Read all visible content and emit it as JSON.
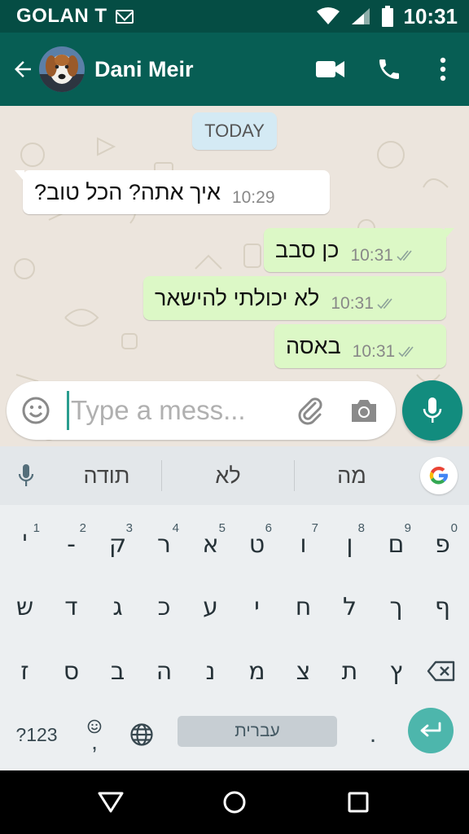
{
  "status_bar": {
    "carrier": "GOLAN T",
    "time": "10:31"
  },
  "app_bar": {
    "contact_name": "Dani Meir"
  },
  "chat": {
    "date_label": "TODAY",
    "messages": [
      {
        "direction": "incoming",
        "text": "איך אתה? הכל טוב?",
        "time": "10:29"
      },
      {
        "direction": "outgoing",
        "text": "כן סבב",
        "time": "10:31",
        "status": "delivered"
      },
      {
        "direction": "outgoing",
        "text": "לא יכולתי להישאר",
        "time": "10:31",
        "status": "delivered"
      },
      {
        "direction": "outgoing",
        "text": "באסה",
        "time": "10:31",
        "status": "delivered"
      }
    ]
  },
  "composer": {
    "placeholder": "Type a mess..."
  },
  "keyboard": {
    "suggestions": [
      "תודה",
      "לא",
      "מה"
    ],
    "row1": [
      {
        "label": "פ",
        "hint": "0"
      },
      {
        "label": "ם",
        "hint": "9"
      },
      {
        "label": "ן",
        "hint": "8"
      },
      {
        "label": "ו",
        "hint": "7"
      },
      {
        "label": "ט",
        "hint": "6"
      },
      {
        "label": "א",
        "hint": "5"
      },
      {
        "label": "ר",
        "hint": "4"
      },
      {
        "label": "ק",
        "hint": "3"
      },
      {
        "label": "-",
        "hint": "2"
      },
      {
        "label": "'",
        "hint": "1"
      }
    ],
    "row2": [
      "ף",
      "ך",
      "ל",
      "ח",
      "י",
      "ע",
      "כ",
      "ג",
      "ד",
      "ש"
    ],
    "row3": [
      "ץ",
      "ת",
      "צ",
      "מ",
      "נ",
      "ה",
      "ב",
      "ס",
      "ז"
    ],
    "symbols_label": "?123",
    "emoji_comma": ",",
    "space_label": "עברית",
    "period_label": "."
  },
  "colors": {
    "status_bar": "#054d44",
    "app_bar": "#075e54",
    "outgoing_bubble": "#dcf8c6",
    "incoming_bubble": "#ffffff",
    "date_chip": "#d4eaf4",
    "accent": "#128c7e",
    "enter_key": "#4db6ac"
  },
  "icons": {
    "back": "arrow-left-icon",
    "video": "video-camera-icon",
    "call": "phone-icon",
    "menu": "more-vert-icon",
    "emoji": "smiley-icon",
    "attach": "paperclip-icon",
    "camera": "camera-icon",
    "mic": "microphone-icon",
    "backspace": "backspace-icon",
    "globe": "globe-icon",
    "enter": "enter-icon",
    "google": "google-g-icon"
  }
}
